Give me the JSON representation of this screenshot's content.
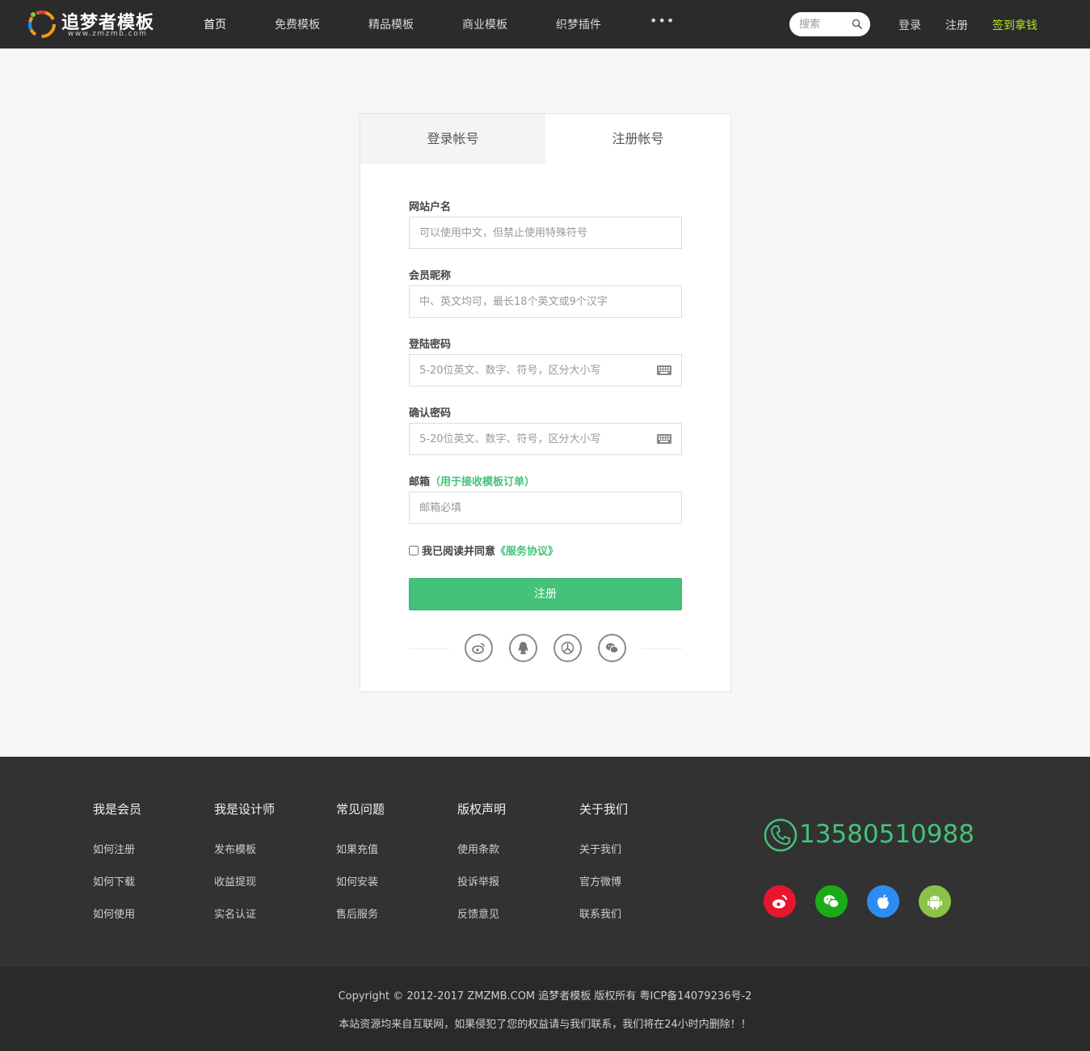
{
  "header": {
    "logo_title": "追梦者模板",
    "logo_sub": "www.zmzmb.com",
    "nav": [
      {
        "label": "首页",
        "active": true
      },
      {
        "label": "免费模板",
        "active": false
      },
      {
        "label": "精品模板",
        "active": false
      },
      {
        "label": "商业模板",
        "active": false
      },
      {
        "label": "织梦插件",
        "active": false
      }
    ],
    "more_label": "•••",
    "search_placeholder": "搜索",
    "login_label": "登录",
    "register_label": "注册",
    "checkin_label": "签到拿钱",
    "checkin_color": "#b5e61d"
  },
  "form": {
    "tabs": {
      "login": "登录帐号",
      "register": "注册帐号"
    },
    "username_label": "网站户名",
    "username_placeholder": "可以使用中文，但禁止使用特殊符号",
    "nickname_label": "会员昵称",
    "nickname_placeholder": "中、英文均可，最长18个英文或9个汉字",
    "password_label": "登陆密码",
    "password_placeholder": "5-20位英文、数字、符号，区分大小写",
    "confirm_label": "确认密码",
    "confirm_placeholder": "5-20位英文、数字、符号，区分大小写",
    "email_label": "邮箱",
    "email_hint": "（用于接收模板订单）",
    "email_placeholder": "邮箱必填",
    "agree_text": "我已阅读并同意",
    "agree_link": "《服务协议》",
    "submit_label": "注册",
    "accent_color": "#45c27a",
    "social_icons": [
      "weibo-icon",
      "qq-icon",
      "baidu-icon",
      "wechat-icon"
    ]
  },
  "footer": {
    "columns": [
      {
        "title": "我是会员",
        "links": [
          "如何注册",
          "如何下载",
          "如何使用"
        ]
      },
      {
        "title": "我是设计师",
        "links": [
          "发布模板",
          "收益提现",
          "实名认证"
        ]
      },
      {
        "title": "常见问题",
        "links": [
          "如果充值",
          "如何安装",
          "售后服务"
        ]
      },
      {
        "title": "版权声明",
        "links": [
          "使用条款",
          "投诉举报",
          "反馈意见"
        ]
      },
      {
        "title": "关于我们",
        "links": [
          "关于我们",
          "官方微博",
          "联系我们"
        ]
      }
    ],
    "phone": "13580510988",
    "apps": [
      {
        "icon": "weibo-icon",
        "color": "#e6162d"
      },
      {
        "icon": "wechat-icon",
        "color": "#1aad19"
      },
      {
        "icon": "apple-icon",
        "color": "#2d8cf0"
      },
      {
        "icon": "android-icon",
        "color": "#8bc34a"
      }
    ],
    "copyright": "Copyright © 2012-2017 ZMZMB.COM 追梦者模板 版权所有 粤ICP备14079236号-2",
    "disclaimer": "本站资源均来自互联网，如果侵犯了您的权益请与我们联系，我们将在24小时内删除！！"
  }
}
